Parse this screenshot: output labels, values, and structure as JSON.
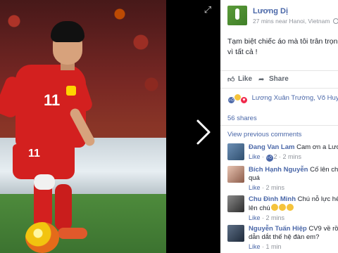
{
  "viewer": {
    "fullscreen_icon": "expand-icon",
    "next_icon": "chevron-right-icon",
    "jersey_number": "11",
    "shorts_number": "11"
  },
  "post": {
    "author": "Lương Dị",
    "meta": "27 mins near Hanoi, Vietnam",
    "text_line1": "Tạm biệt chiếc áo mà tôi trân trọn",
    "text_line2": "vì tất cả !"
  },
  "actions": {
    "like_label": "Like",
    "share_label": "Share"
  },
  "reactions": {
    "names": "Lương Xuân Trường, Võ Huy"
  },
  "shares_label": "56 shares",
  "view_previous_label": "View previous comments",
  "comments": [
    {
      "name": "Đang Van Lam",
      "text": "Cam ơn a Lương",
      "like_label": "Like",
      "likes": "2",
      "time": "2 mins"
    },
    {
      "name": "Bích Hạnh Nguyễn",
      "text": "Cố lên chú",
      "text2": "quá",
      "like_label": "Like",
      "time": "2 mins"
    },
    {
      "name": "Chu Đình Minh",
      "text": "Chú nỗ lực hết",
      "text2": "lên chú",
      "like_label": "Like",
      "time": "2 mins"
    },
    {
      "name": "Nguyễn Tuấn Hiệp",
      "text": "CV9 về rồi",
      "text2": "dẫn dắt thế hệ đàn em?",
      "like_label": "Like",
      "time": "1 min"
    }
  ],
  "colors": {
    "link_blue": "#4a67a8",
    "meta_gray": "#90949c",
    "jersey_red": "#d3201f"
  }
}
